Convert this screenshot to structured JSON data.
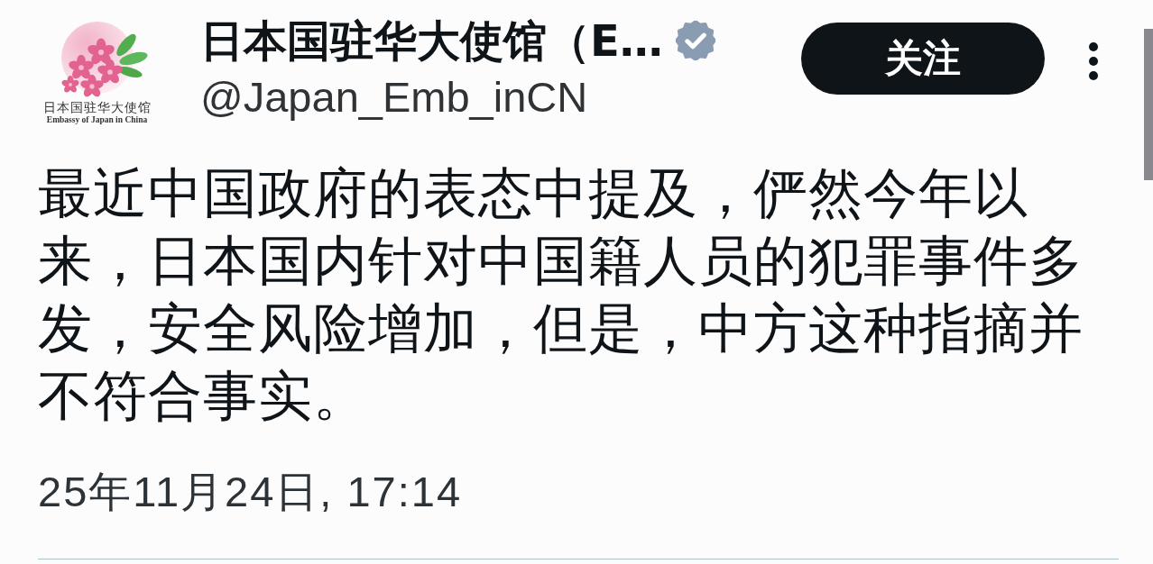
{
  "account": {
    "logo_title": "日本国驻华大使馆",
    "logo_subtitle": "Embassy of Japan in China",
    "name": "日本国驻华大使馆（E…",
    "verified": true,
    "handle": "@Japan_Emb_inCN"
  },
  "follow_button": {
    "label": "关注"
  },
  "post": {
    "text": "最近中国政府的表态中提及，俨然今年以来，日本国内针对中国籍人员的犯罪事件多发，安全风险增加，但是，中方这种指摘并不符合事实。",
    "timestamp": "25年11月24日, 17:14"
  }
}
